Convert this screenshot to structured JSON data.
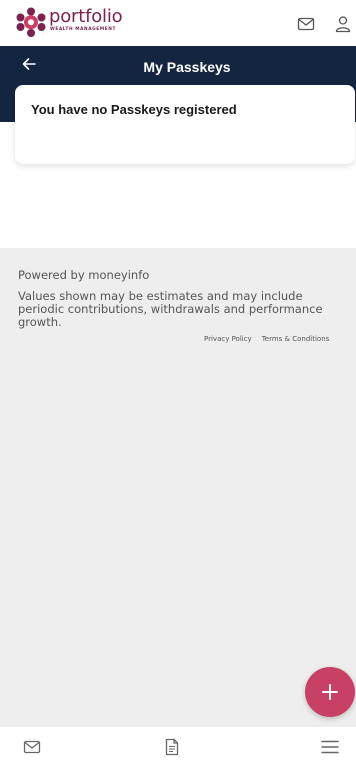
{
  "brand": {
    "name": "portfolio",
    "tagline": "WEALTH MANAGEMENT",
    "color": "#7a2350",
    "accent": "#c94066"
  },
  "header": {
    "icons": [
      "mail-icon",
      "user-icon"
    ]
  },
  "navbar": {
    "title": "My Passkeys",
    "back_icon": "arrow-left-icon",
    "background": "#14253f"
  },
  "passkeys": {
    "empty_message": "You have no Passkeys registered"
  },
  "footer": {
    "powered_by": "Powered by moneyinfo",
    "disclaimer": "Values shown may be estimates and may include periodic contributions, withdrawals and performance growth.",
    "links": [
      "Privacy Policy",
      "Terms & Conditions"
    ]
  },
  "fab": {
    "icon": "plus-icon",
    "color": "#c94066"
  },
  "bottom_nav": {
    "icons": [
      "mail-icon",
      "document-icon",
      "menu-icon"
    ]
  }
}
